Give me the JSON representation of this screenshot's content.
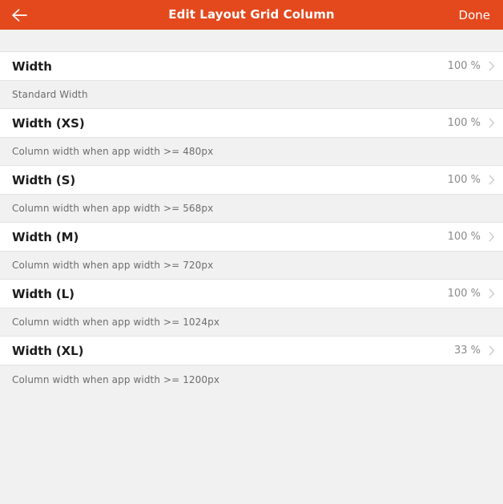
{
  "header": {
    "back_icon": "back-arrow-icon",
    "title": "Edit Layout Grid Column",
    "done_label": "Done",
    "background_color": "#e4491e",
    "text_color": "#ffffff"
  },
  "settings": {
    "rows": [
      {
        "label": "Width",
        "value": "100 %",
        "chevron": "chevron-right-icon",
        "description": "Standard Width"
      },
      {
        "label": "Width (XS)",
        "value": "100 %",
        "chevron": "chevron-right-icon",
        "description": "Column width when app width >= 480px"
      },
      {
        "label": "Width (S)",
        "value": "100 %",
        "chevron": "chevron-right-icon",
        "description": "Column width when app width >= 568px"
      },
      {
        "label": "Width (M)",
        "value": "100 %",
        "chevron": "chevron-right-icon",
        "description": "Column width when app width >= 720px"
      },
      {
        "label": "Width (L)",
        "value": "100 %",
        "chevron": "chevron-right-icon",
        "description": "Column width when app width >= 1024px"
      },
      {
        "label": "Width (XL)",
        "value": "33 %",
        "chevron": "chevron-right-icon",
        "description": "Column width when app width >= 1200px"
      }
    ]
  },
  "colors": {
    "page_background": "#f1f1f1",
    "row_background": "#ffffff",
    "divider": "#e3e3e3",
    "label_text": "#1d1d1d",
    "value_text": "#8a8a8a",
    "description_text": "#6d6d6d",
    "chevron": "#c9c9c9"
  }
}
